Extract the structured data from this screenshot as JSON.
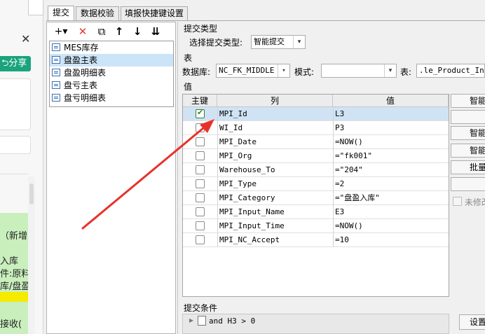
{
  "bg_panel": {
    "share_label": "分享",
    "close_glyph": "✕",
    "lines": [
      "（新增)",
      "入库",
      "件:原料",
      "库/盘盈",
      "接收("
    ]
  },
  "tabs": [
    {
      "label": "提交",
      "active": true
    },
    {
      "label": "数据校验",
      "active": false
    },
    {
      "label": "填报快捷键设置",
      "active": false
    }
  ],
  "tree": {
    "toolbar": [
      {
        "name": "add-icon",
        "glyph": "+▾"
      },
      {
        "name": "delete-icon",
        "glyph": "✕"
      },
      {
        "name": "copy-icon",
        "glyph": "⧉"
      },
      {
        "name": "move-up-icon",
        "glyph": "↑"
      },
      {
        "name": "move-down-icon",
        "glyph": "↓"
      },
      {
        "name": "move-bottom-icon",
        "glyph": "⇊"
      }
    ],
    "items": [
      {
        "label": "MES库存",
        "selected": false
      },
      {
        "label": "盘盈主表",
        "selected": true
      },
      {
        "label": "盘盈明细表",
        "selected": false
      },
      {
        "label": "盘亏主表",
        "selected": false
      },
      {
        "label": "盘亏明细表",
        "selected": false
      }
    ]
  },
  "submit_type": {
    "section": "提交类型",
    "label": "选择提交类型:",
    "value": "智能提交"
  },
  "table_section": {
    "section": "表",
    "db_label": "数据库:",
    "db_value": "NC_FK_MIDDLE",
    "schema_label": "模式:",
    "schema_value": "",
    "table_label": "表:",
    "table_value": ".le_Product_In"
  },
  "value_section": {
    "section": "值",
    "headers": {
      "key": "主键",
      "col": "列",
      "val": "值"
    },
    "rows": [
      {
        "key": true,
        "col": "MPI_Id",
        "val": "L3",
        "selected": true
      },
      {
        "key": false,
        "col": "WI_Id",
        "val": "P3",
        "selected": false
      },
      {
        "key": false,
        "col": "MPI_Date",
        "val": "=NOW()",
        "selected": false
      },
      {
        "key": false,
        "col": "MPI_Org",
        "val": "=\"fk001\"",
        "selected": false
      },
      {
        "key": false,
        "col": "Warehouse_To",
        "val": "=\"204\"",
        "selected": false
      },
      {
        "key": false,
        "col": "MPI_Type",
        "val": "=2",
        "selected": false
      },
      {
        "key": false,
        "col": "MPI_Category",
        "val": "=\"盘盈入库\"",
        "selected": false
      },
      {
        "key": false,
        "col": "MPI_Input_Name",
        "val": "E3",
        "selected": false
      },
      {
        "key": false,
        "col": "MPI_Input_Time",
        "val": "=NOW()",
        "selected": false
      },
      {
        "key": false,
        "col": "MPI_NC_Accept",
        "val": "=10",
        "selected": false
      }
    ]
  },
  "side_buttons": [
    "智能",
    "",
    "智能",
    "智能",
    "批量",
    ""
  ],
  "unmodified_label": "未修改",
  "condition": {
    "section": "提交条件",
    "item": "and H3 > 0",
    "settings_button": "设置"
  },
  "accent_red": "#e8312a"
}
